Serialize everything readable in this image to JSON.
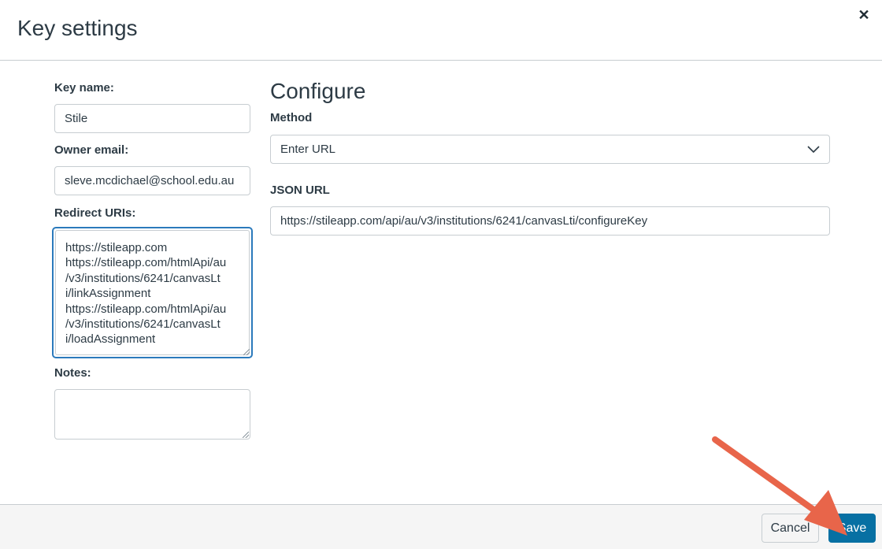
{
  "header": {
    "title": "Key settings",
    "close_glyph": "✕"
  },
  "left": {
    "key_name": {
      "label": "Key name:",
      "value": "Stile"
    },
    "owner_email": {
      "label": "Owner email:",
      "value": "sleve.mcdichael@school.edu.au"
    },
    "redirect_uris": {
      "label": "Redirect URIs:",
      "lines": [
        "https://stileapp.com",
        "https://stileapp.com/htmlApi/au",
        "/v3/institutions/6241/canvasLt",
        "i/linkAssignment",
        "https://stileapp.com/htmlApi/au",
        "/v3/institutions/6241/canvasLt",
        "i/loadAssignment"
      ]
    },
    "notes": {
      "label": "Notes:",
      "value": ""
    }
  },
  "configure": {
    "heading": "Configure",
    "method": {
      "label": "Method",
      "selected": "Enter URL"
    },
    "json_url": {
      "label": "JSON URL",
      "value": "https://stileapp.com/api/au/v3/institutions/6241/canvasLti/configureKey"
    }
  },
  "footer": {
    "cancel_label": "Cancel",
    "save_label": "Save"
  },
  "colors": {
    "primary": "#0770a3",
    "focus": "#2b7abc",
    "annotation_arrow": "#e8654a"
  },
  "icons": {
    "close": "close-icon",
    "select": "chevron-down-icon",
    "annotation": "annotation-arrow-icon"
  }
}
